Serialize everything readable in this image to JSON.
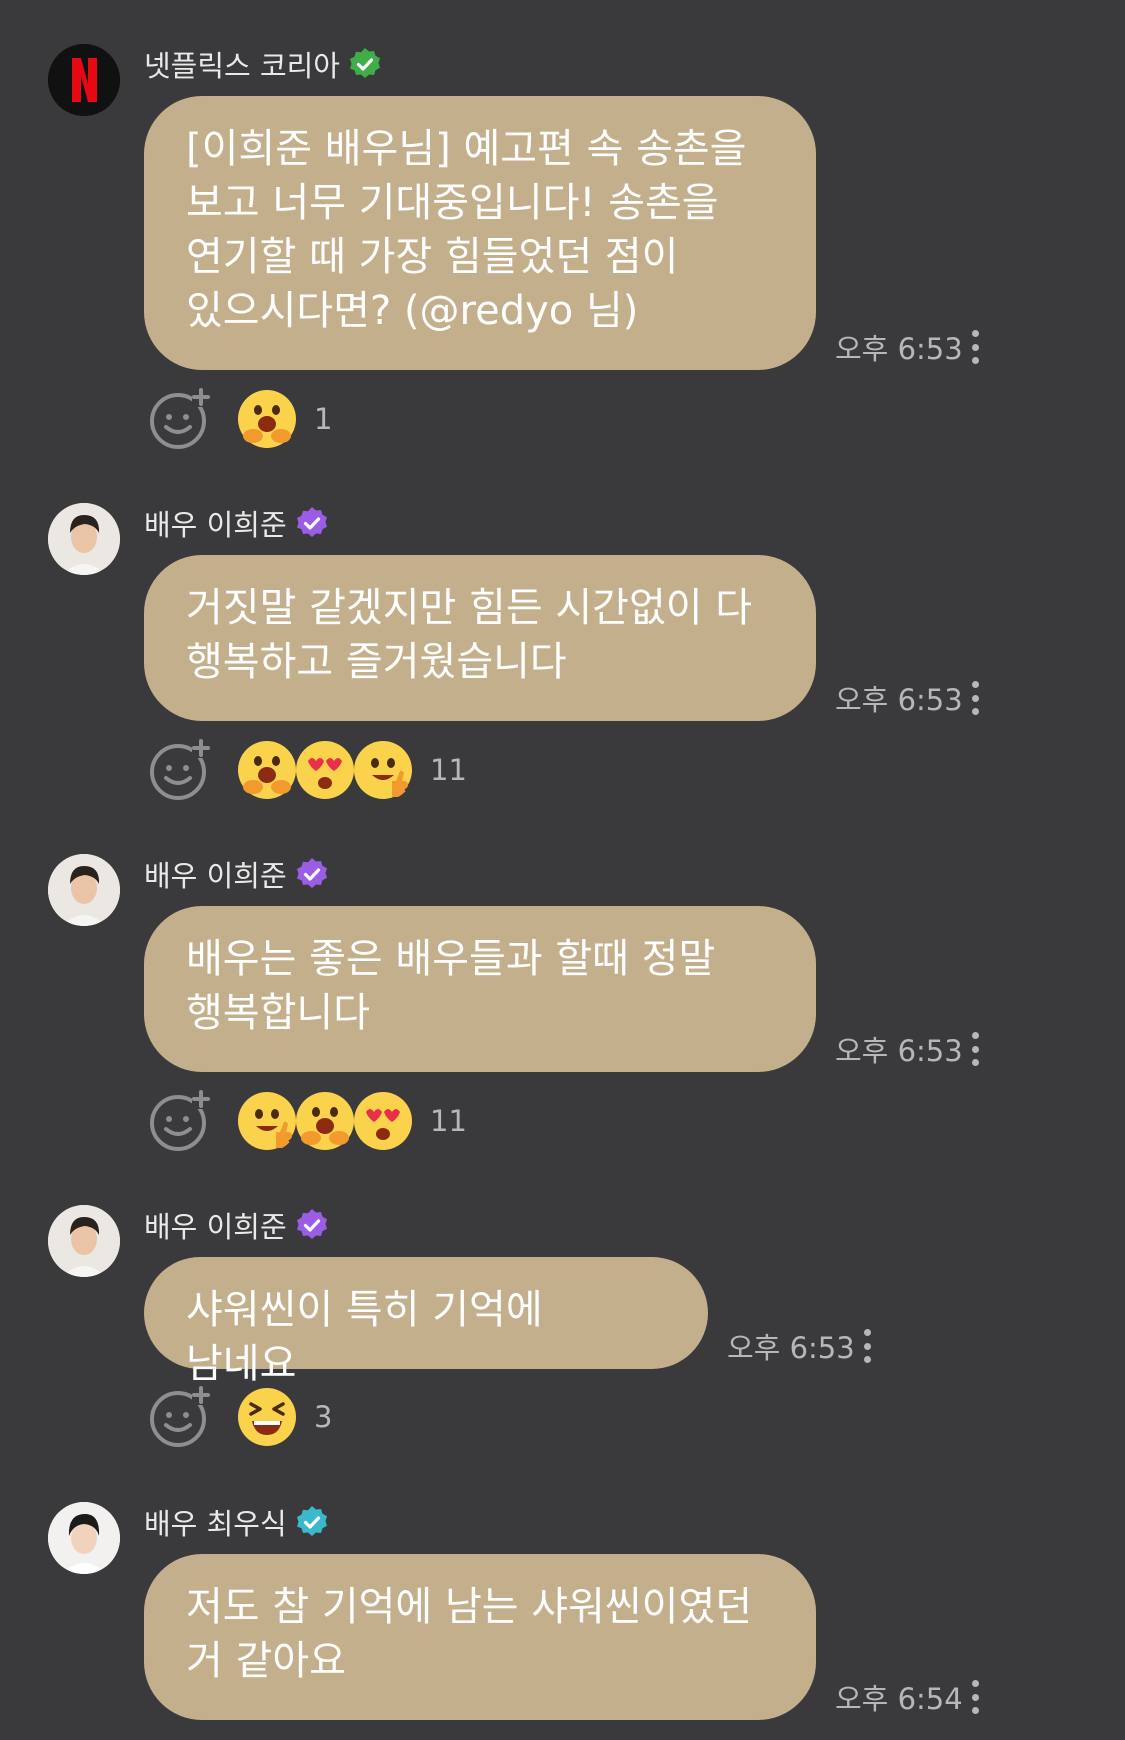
{
  "messages": [
    {
      "sender": "넷플릭스 코리아",
      "badge_color": "#3fae49",
      "avatar": "netflix-logo",
      "text": "[이희준 배우님] 예고편 속 송촌을 보고 너무 기대중입니다! 송촌을 연기할 때 가장 힘들었던 점이 있으시다면? (@redyo 님)",
      "time": "오후 6:53",
      "reactions": [
        "grinning-hands-emoji"
      ],
      "reaction_count": "1"
    },
    {
      "sender": "배우 이희준",
      "badge_color": "#9b5de5",
      "avatar": "actor-photo",
      "text": "거짓말 같겠지만 힘든 시간없이 다 행복하고 즐거웠습니다",
      "time": "오후 6:53",
      "reactions": [
        "grinning-hands-emoji",
        "heart-eyes-emoji",
        "thumbs-up-emoji"
      ],
      "reaction_count": "11"
    },
    {
      "sender": "배우 이희준",
      "badge_color": "#9b5de5",
      "avatar": "actor-photo",
      "text": "배우는 좋은 배우들과 할때 정말 행복합니다",
      "time": "오후 6:53",
      "reactions": [
        "thumbs-up-emoji",
        "grinning-hands-emoji",
        "heart-eyes-emoji"
      ],
      "reaction_count": "11"
    },
    {
      "sender": "배우 이희준",
      "badge_color": "#9b5de5",
      "avatar": "actor-photo",
      "text": "샤워씬이 특히 기억에 남네요",
      "time": "오후 6:53",
      "reactions": [
        "laughing-emoji"
      ],
      "reaction_count": "3"
    },
    {
      "sender": "배우 최우식",
      "badge_color": "#3bb8c9",
      "avatar": "actor-photo-2",
      "text": "저도 참 기억에 남는 샤워씬이였던 거 같아요",
      "time": "오후 6:54",
      "reactions": [],
      "reaction_count": ""
    }
  ]
}
